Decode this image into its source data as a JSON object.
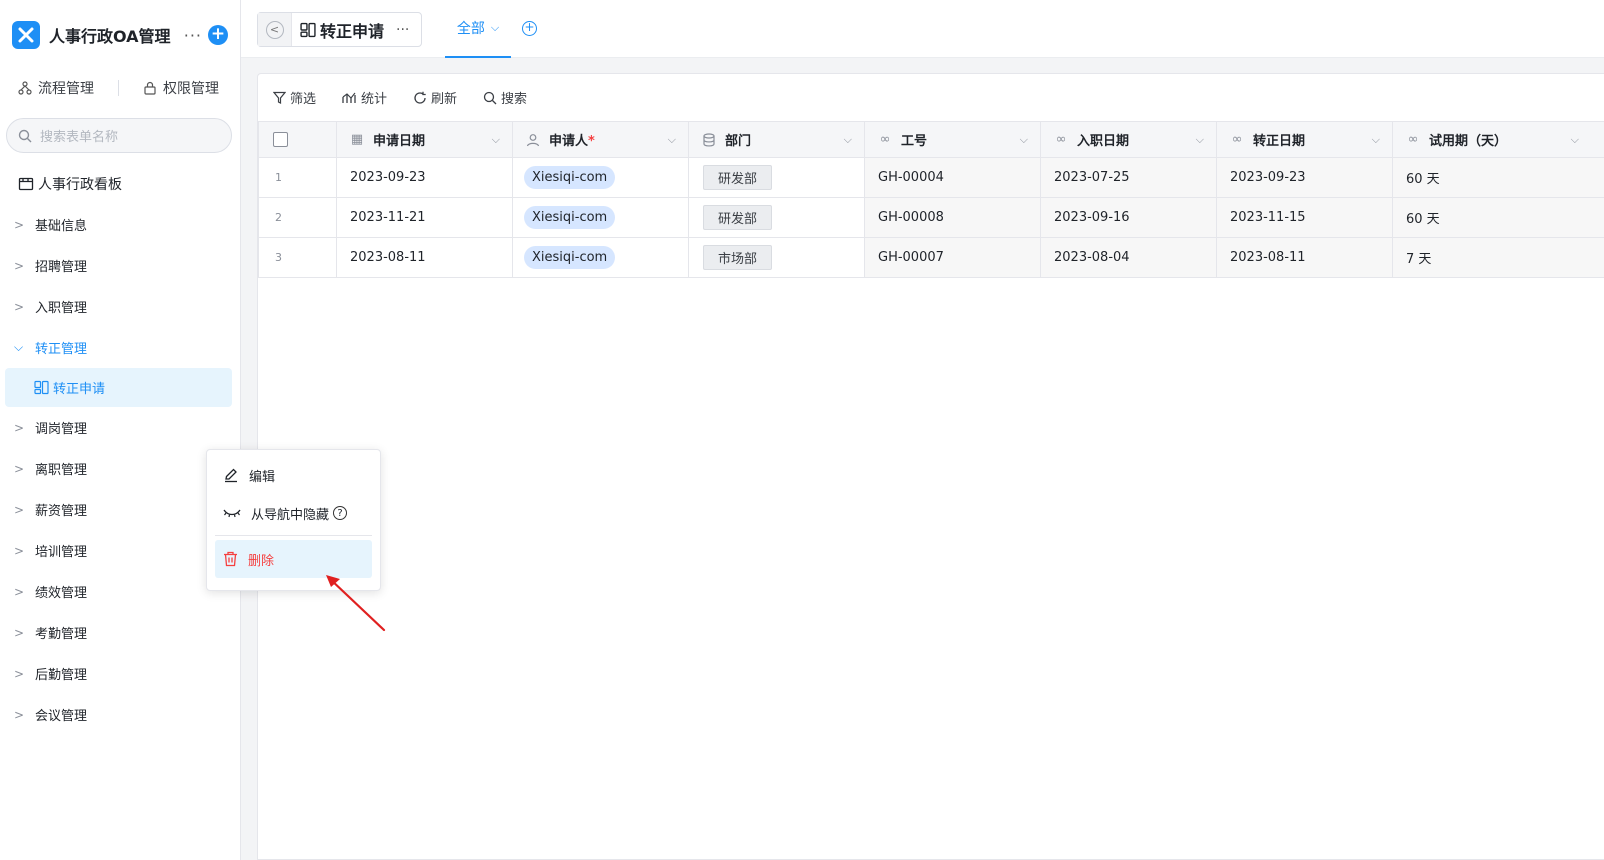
{
  "app": {
    "title": "人事行政OA管理",
    "logo_color": "#1e8ff5"
  },
  "sidebar": {
    "mgmt": {
      "process": "流程管理",
      "permission": "权限管理"
    },
    "search_placeholder": "搜索表单名称",
    "board": "人事行政看板",
    "items": [
      {
        "label": "基础信息"
      },
      {
        "label": "招聘管理"
      },
      {
        "label": "入职管理"
      },
      {
        "label": "转正管理"
      },
      {
        "label": "调岗管理"
      },
      {
        "label": "离职管理"
      },
      {
        "label": "薪资管理"
      },
      {
        "label": "培训管理"
      },
      {
        "label": "绩效管理"
      },
      {
        "label": "考勤管理"
      },
      {
        "label": "后勤管理"
      },
      {
        "label": "会议管理"
      }
    ],
    "active_sub": "转正申请"
  },
  "topbar": {
    "tab_name": "转正申请",
    "view_label": "全部"
  },
  "toolbar": {
    "filter": "筛选",
    "stats": "统计",
    "refresh": "刷新",
    "search": "搜索"
  },
  "table": {
    "headers": [
      "申请日期",
      "申请人",
      "部门",
      "工号",
      "入职日期",
      "转正日期",
      "试用期（天）"
    ],
    "rows": [
      {
        "idx": "1",
        "apply_date": "2023-09-23",
        "applicant": "Xiesiqi-com",
        "dept": "研发部",
        "emp_no": "GH-00004",
        "join_date": "2023-07-25",
        "regular_date": "2023-09-23",
        "probation": "60 天"
      },
      {
        "idx": "2",
        "apply_date": "2023-11-21",
        "applicant": "Xiesiqi-com",
        "dept": "研发部",
        "emp_no": "GH-00008",
        "join_date": "2023-09-16",
        "regular_date": "2023-11-15",
        "probation": "60 天"
      },
      {
        "idx": "3",
        "apply_date": "2023-08-11",
        "applicant": "Xiesiqi-com",
        "dept": "市场部",
        "emp_no": "GH-00007",
        "join_date": "2023-08-04",
        "regular_date": "2023-08-11",
        "probation": "7 天"
      }
    ]
  },
  "context_menu": {
    "edit": "编辑",
    "hide": "从导航中隐藏",
    "delete": "删除"
  },
  "colors": {
    "accent": "#1e8ff5",
    "danger": "#f53f3f",
    "annotation": "#e02020"
  }
}
